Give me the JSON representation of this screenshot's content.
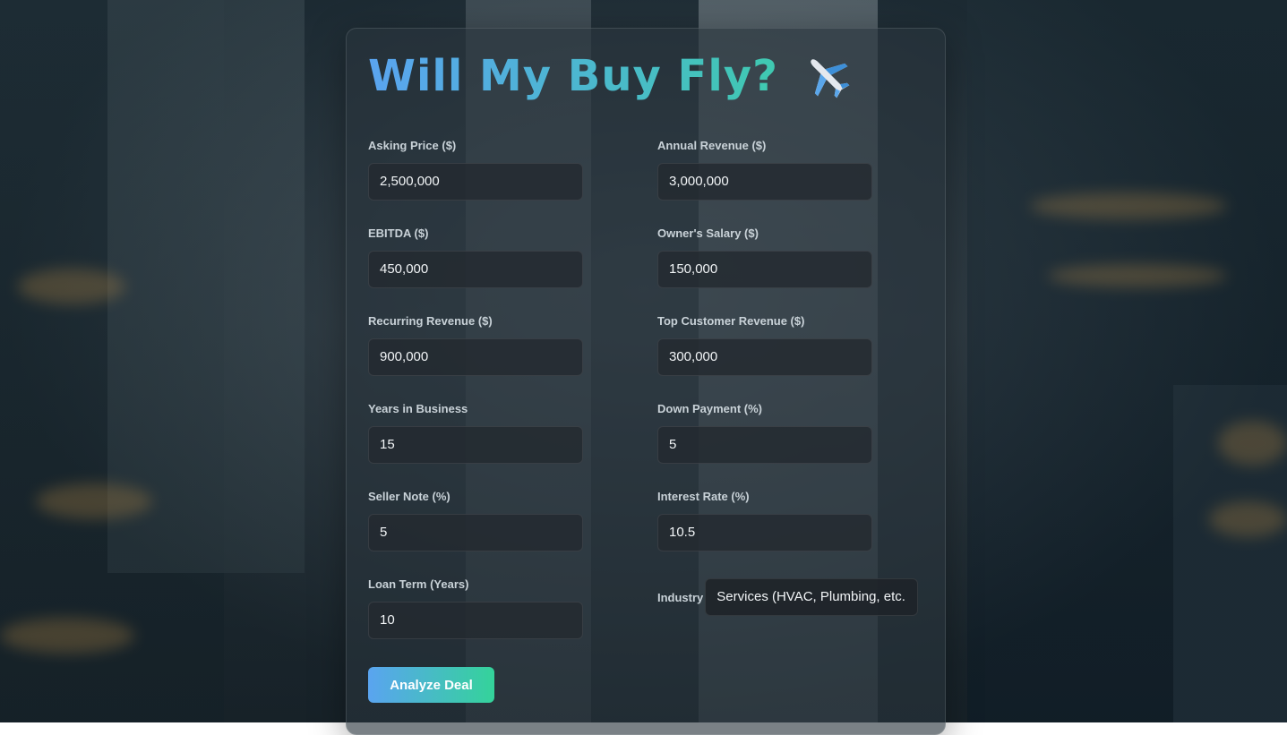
{
  "app": {
    "title": "Will My Buy Fly?",
    "title_icon": "airplane-icon"
  },
  "form": {
    "asking_price": {
      "label": "Asking Price ($)",
      "value": "2,500,000"
    },
    "annual_revenue": {
      "label": "Annual Revenue ($)",
      "value": "3,000,000"
    },
    "ebitda": {
      "label": "EBITDA ($)",
      "value": "450,000"
    },
    "owners_salary": {
      "label": "Owner's Salary ($)",
      "value": "150,000"
    },
    "recurring_revenue": {
      "label": "Recurring Revenue ($)",
      "value": "900,000"
    },
    "top_customer_revenue": {
      "label": "Top Customer Revenue ($)",
      "value": "300,000"
    },
    "years_in_business": {
      "label": "Years in Business",
      "value": "15"
    },
    "down_payment": {
      "label": "Down Payment (%)",
      "value": "5"
    },
    "seller_note": {
      "label": "Seller Note (%)",
      "value": "5"
    },
    "interest_rate": {
      "label": "Interest Rate (%)",
      "value": "10.5"
    },
    "loan_term": {
      "label": "Loan Term (Years)",
      "value": "10"
    },
    "industry": {
      "label": "Industry",
      "selected": "Services (HVAC, Plumbing, etc."
    }
  },
  "actions": {
    "analyze_label": "Analyze Deal"
  },
  "colors": {
    "gradient_start": "#5aa4f0",
    "gradient_end": "#34d39a"
  }
}
